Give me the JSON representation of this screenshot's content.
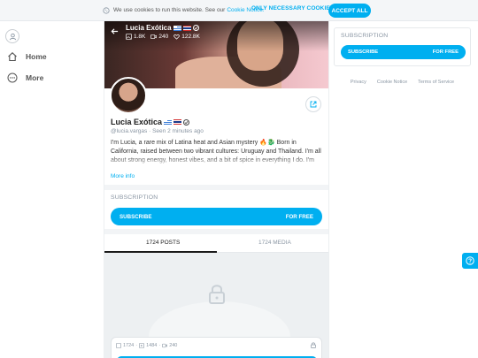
{
  "cookie_bar": {
    "text": "We use cookies to run this website. See our",
    "link": "Cookie Notice.",
    "necessary_label": "ONLY NECESSARY COOKIES",
    "accept_label": "ACCEPT ALL"
  },
  "nav": {
    "items": [
      {
        "label": "Home",
        "icon": "home-icon"
      },
      {
        "label": "More",
        "icon": "more-dots-icon"
      }
    ]
  },
  "profile": {
    "name": "Lucia Exótica",
    "stats": {
      "photos": "1.8K",
      "videos": "240",
      "likes": "122.8K"
    },
    "handle": "@lucia.vargas",
    "seen": "Seen  2 minutes ago",
    "bio": "I'm Lucia, a rare mix of Latina heat and Asian mystery 🔥🐉 Born in California, raised between two vibrant cultures: Uruguay and Thailand. I'm all about strong energy, honest vibes, and a bit of spice in everything I do. I'm currently studying",
    "more_info": "More info"
  },
  "subscription": {
    "title": "SUBSCRIPTION",
    "subscribe_label": "SUBSCRIBE",
    "price_label": "FOR FREE"
  },
  "tabs": [
    {
      "label": "1724 POSTS",
      "active": true
    },
    {
      "label": "1724 MEDIA",
      "active": false
    }
  ],
  "post_card": {
    "photos": "1724",
    "media": "1484",
    "videos": "240"
  },
  "footer_links": [
    "Privacy",
    "Cookie Notice",
    "Terms of Service"
  ],
  "colors": {
    "accent": "#00aff0",
    "muted": "#8a96a3"
  }
}
